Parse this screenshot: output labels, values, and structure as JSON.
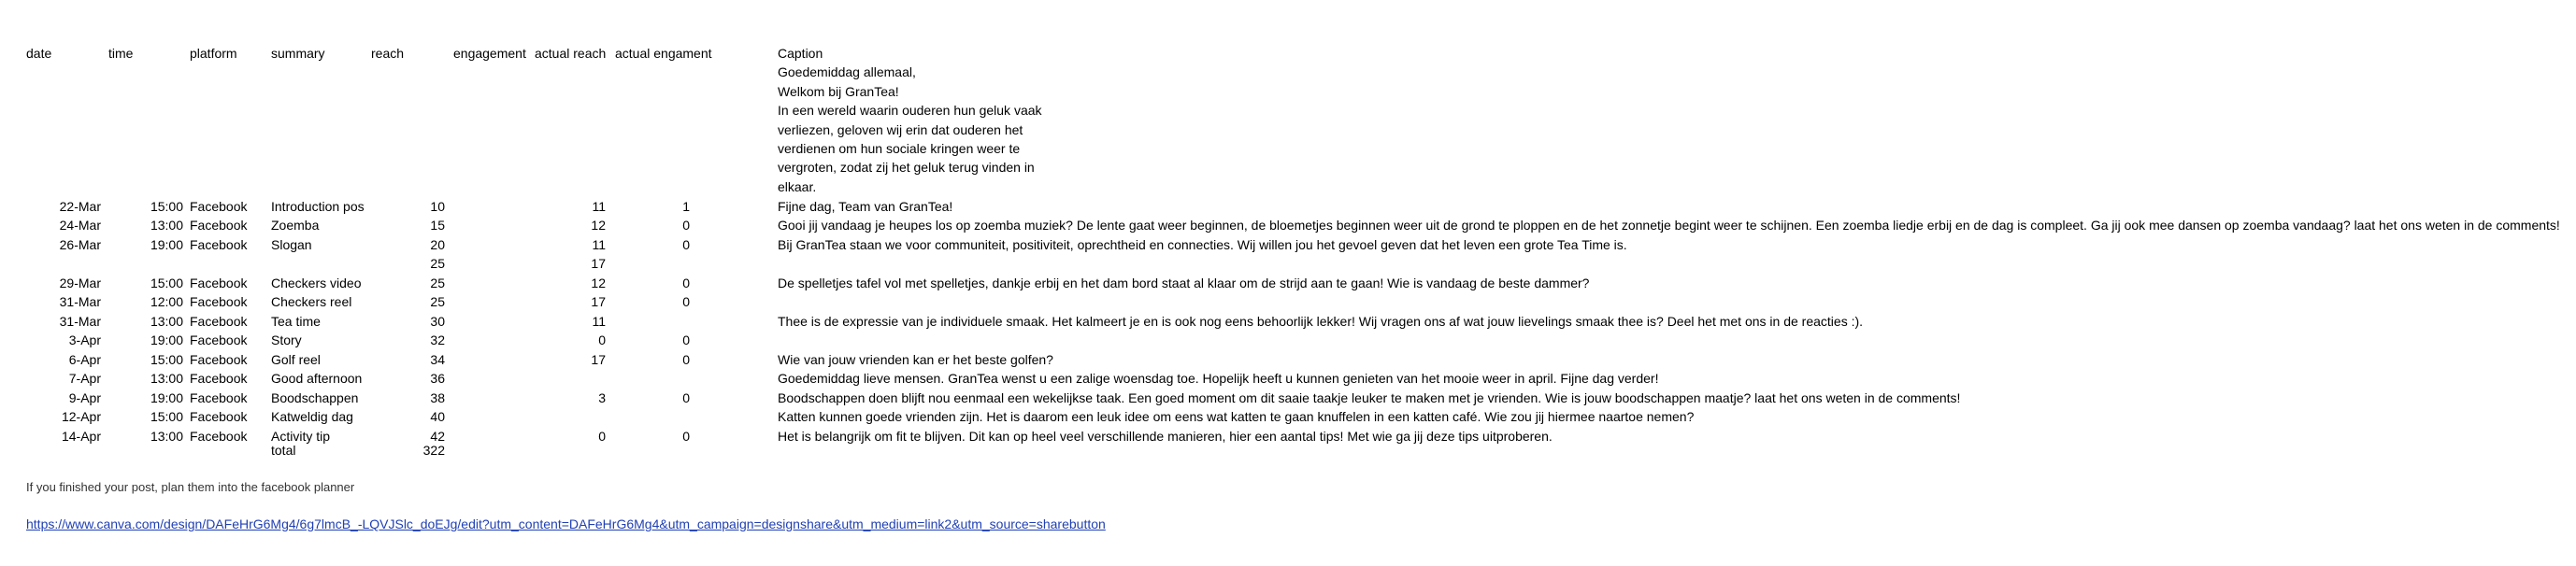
{
  "headers": {
    "date": "date",
    "time": "time",
    "platform": "platform",
    "summary": "summary",
    "reach": "reach",
    "engagement": "engagement",
    "actual_reach": "actual reach",
    "actual_engagement": "actual engament",
    "caption": "Caption"
  },
  "intro_caption": [
    "Goedemiddag allemaal,",
    "Welkom bij GranTea!",
    "In een wereld waarin ouderen hun geluk vaak",
    "verliezen, geloven wij erin dat ouderen het",
    "verdienen om hun sociale kringen weer te",
    "vergroten, zodat zij het geluk terug vinden in",
    "elkaar."
  ],
  "rows": [
    {
      "date": "22-Mar",
      "time": "15:00",
      "platform": "Facebook",
      "summary": "Introduction post",
      "reach": "10",
      "engagement": "",
      "actual_reach": "11",
      "actual_engagement": "1",
      "caption": "Fijne dag, Team van GranTea!"
    },
    {
      "date": "24-Mar",
      "time": "13:00",
      "platform": "Facebook",
      "summary": "Zoemba",
      "reach": "15",
      "engagement": "",
      "actual_reach": "12",
      "actual_engagement": "0",
      "caption": "Gooi jij vandaag je heupes los op zoemba muziek? De lente gaat weer beginnen, de bloemetjes beginnen weer uit de grond te ploppen en de het zonnetje begint weer te schijnen. Een zoemba liedje erbij en de dag is compleet. Ga jij ook mee dansen op zoemba vandaag? laat het ons weten in de comments!"
    },
    {
      "date": "26-Mar",
      "time": "19:00",
      "platform": "Facebook",
      "summary": "Slogan",
      "reach": "20",
      "engagement": "",
      "actual_reach": "11",
      "actual_engagement": "0",
      "caption": "Bij GranTea staan we voor communiteit, positiviteit, oprechtheid en connecties. Wij willen jou het gevoel geven dat het leven een grote Tea Time is."
    },
    {
      "date": "",
      "time": "",
      "platform": "",
      "summary": "",
      "reach": "25",
      "engagement": "",
      "actual_reach": "17",
      "actual_engagement": "",
      "caption": ""
    },
    {
      "date": "29-Mar",
      "time": "15:00",
      "platform": "Facebook",
      "summary": "Checkers video",
      "reach": "25",
      "engagement": "",
      "actual_reach": "12",
      "actual_engagement": "0",
      "caption": "De spelletjes tafel vol met spelletjes, dankje erbij en het dam bord staat al klaar om de strijd aan te gaan! Wie is vandaag de beste dammer?"
    },
    {
      "date": "31-Mar",
      "time": "12:00",
      "platform": "Facebook",
      "summary": "Checkers reel",
      "reach": "25",
      "engagement": "",
      "actual_reach": "17",
      "actual_engagement": "0",
      "caption": ""
    },
    {
      "date": "31-Mar",
      "time": "13:00",
      "platform": "Facebook",
      "summary": "Tea time",
      "reach": "30",
      "engagement": "",
      "actual_reach": "11",
      "actual_engagement": "",
      "caption": "Thee is de expressie van je individuele smaak. Het kalmeert je en is ook nog eens behoorlijk lekker! Wij vragen ons af wat jouw lievelings smaak thee is? Deel het met ons in de reacties :)."
    },
    {
      "date": "3-Apr",
      "time": "19:00",
      "platform": "Facebook",
      "summary": "Story",
      "reach": "32",
      "engagement": "",
      "actual_reach": "0",
      "actual_engagement": "0",
      "caption": ""
    },
    {
      "date": "6-Apr",
      "time": "15:00",
      "platform": "Facebook",
      "summary": "Golf reel",
      "reach": "34",
      "engagement": "",
      "actual_reach": "17",
      "actual_engagement": "0",
      "caption": "Wie van jouw vrienden kan er het beste golfen?"
    },
    {
      "date": "7-Apr",
      "time": "13:00",
      "platform": "Facebook",
      "summary": "Good afternoon",
      "reach": "36",
      "engagement": "",
      "actual_reach": "",
      "actual_engagement": "",
      "caption": "Goedemiddag lieve mensen. GranTea wenst u een zalige woensdag toe. Hopelijk heeft u kunnen genieten van het mooie weer in april. Fijne dag verder!"
    },
    {
      "date": "9-Apr",
      "time": "19:00",
      "platform": "Facebook",
      "summary": "Boodschappen",
      "reach": "38",
      "engagement": "",
      "actual_reach": "3",
      "actual_engagement": "0",
      "caption": "Boodschappen doen blijft nou eenmaal een wekelijkse taak. Een goed moment om dit saaie taakje leuker te maken met je vrienden. Wie is jouw boodschappen maatje? laat het ons weten in de comments!"
    },
    {
      "date": "12-Apr",
      "time": "15:00",
      "platform": "Facebook",
      "summary": "Katweldig dag",
      "reach": "40",
      "engagement": "",
      "actual_reach": "",
      "actual_engagement": "",
      "caption": "Katten kunnen goede vrienden zijn. Het is daarom een leuk idee om eens wat katten te gaan knuffelen in een katten café. Wie zou jij hiermee naartoe nemen?"
    },
    {
      "date": "14-Apr",
      "time": "13:00",
      "platform": "Facebook",
      "summary": "Activity tip",
      "reach": "42",
      "engagement": "",
      "actual_reach": "0",
      "actual_engagement": "0",
      "caption": "Het is belangrijk om fit te blijven. Dit kan op heel veel verschillende manieren, hier een aantal tips! Met wie ga jij deze tips uitproberen."
    }
  ],
  "total": {
    "label": "total",
    "value": "322"
  },
  "note": "If you finished your post, plan them into the facebook planner",
  "link": "https://www.canva.com/design/DAFeHrG6Mg4/6g7lmcB_-LQVJSlc_doEJg/edit?utm_content=DAFeHrG6Mg4&utm_campaign=designshare&utm_medium=link2&utm_source=sharebutton"
}
